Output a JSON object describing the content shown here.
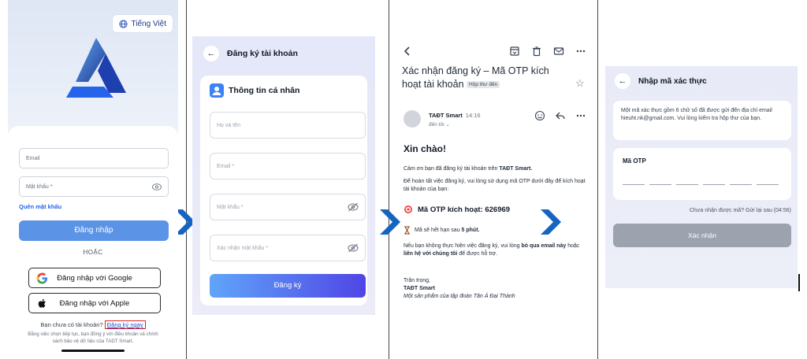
{
  "panel1": {
    "language_label": "Tiếng Việt",
    "email_placeholder": "Email",
    "password_placeholder": "Mật khẩu *",
    "forgot_label": "Quên mật khẩu",
    "login_label": "Đăng nhập",
    "or_label": "HOẶC",
    "google_label": "Đăng nhập với Google",
    "apple_label": "Đăng nhập với Apple",
    "no_account_text": "Bạn chưa có tài khoản?",
    "signup_label": "Đăng ký ngay",
    "terms_text": "Bằng việc chọn tiếp tục, bạn đồng ý với điều khoản và chính sách bảo vệ dữ liệu của TADT Smart."
  },
  "panel2": {
    "title": "Đăng ký tài khoản",
    "section_title": "Thông tin cá nhân",
    "name_placeholder": "Họ và tên",
    "email_placeholder": "Email *",
    "password_placeholder": "Mật khẩu *",
    "confirm_placeholder": "Xác nhận mật khẩu *",
    "submit_label": "Đăng ký"
  },
  "panel3": {
    "subject": "Xác nhận đăng ký – Mã OTP kích hoạt tài khoản",
    "inbox_tag": "Hộp thư đến",
    "sender": "TAĐT Smart",
    "time": "14:16",
    "to_label": "đến tôi ⌄",
    "greeting": "Xin chào!",
    "thanks_prefix": "Cảm ơn bạn đã đăng ký tài khoản trên ",
    "thanks_brand": "TAĐT Smart.",
    "instruction": "Để hoàn tất việc đăng ký, vui lòng sử dụng mã OTP dưới đây để kích hoạt tài khoản của bạn:",
    "otp_line": "Mã OTP kích hoạt: 626969",
    "expiry_prefix": "Mã sẽ hết hạn sau ",
    "expiry_value": "5 phút.",
    "ignore_prefix": "Nếu bạn không thực hiện việc đăng ký, vui lòng ",
    "ignore_bold": "bỏ qua email này",
    "ignore_mid": " hoặc ",
    "contact_bold": "liên hệ với chúng tôi",
    "ignore_suffix": " để được hỗ trợ.",
    "signoff": "Trân trọng,",
    "signature": "TAĐT Smart",
    "tagline": "Một sản phẩm của tập đoàn Tân Á Đại Thành"
  },
  "panel4": {
    "title": "Nhập mã xác thực",
    "note": "Một mã xác thực gồm 6 chữ số đã được gửi đến địa chỉ email hieuht.nk@gmail.com. Vui lòng kiểm tra hộp thư của bạn.",
    "otp_label": "Mã OTP",
    "resend_text": "Chưa nhận được mã? Gửi lại sau (04:56)",
    "confirm_label": "Xác nhận"
  },
  "colors": {
    "arrow": "#1565c0",
    "primary": "#5b93e6",
    "signup_highlight": "#dc2626"
  }
}
